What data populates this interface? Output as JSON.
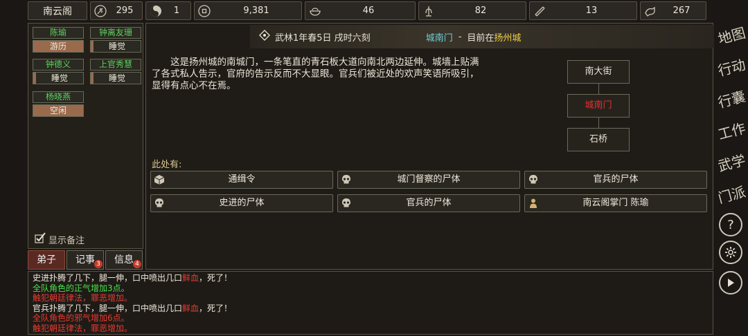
{
  "topbar": {
    "sect_name": "南云阁",
    "resources": [
      {
        "icon": "wheat-icon",
        "value": "295"
      },
      {
        "icon": "yinyang-icon",
        "value": "1"
      },
      {
        "icon": "coin-icon",
        "value": "9,381"
      },
      {
        "icon": "food-bowl-icon",
        "value": "46"
      },
      {
        "icon": "herb-icon",
        "value": "82"
      },
      {
        "icon": "scroll-icon",
        "value": "13"
      },
      {
        "icon": "beast-icon",
        "value": "267"
      }
    ]
  },
  "members": [
    {
      "name": "陈瑜",
      "state": "游历"
    },
    {
      "name": "钟离友珊",
      "state": "睡觉"
    },
    {
      "name": "钟德义",
      "state": "睡觉"
    },
    {
      "name": "上官秀慧",
      "state": "睡觉"
    },
    {
      "name": "杨晓燕",
      "state": "空闲"
    }
  ],
  "left": {
    "show_notes": "显示备注"
  },
  "tabs": [
    {
      "label": "弟子",
      "badge": ""
    },
    {
      "label": "记事",
      "badge": "3"
    },
    {
      "label": "信息",
      "badge": "4"
    }
  ],
  "header": {
    "date": "武林1年春5日 戌时六刻",
    "location": "城南门",
    "separator": "-",
    "now_label": "目前在",
    "city": "扬州城"
  },
  "description": "这是扬州城的南城门，一条笔直的青石板大道向南北两边延伸。城墙上贴满了各式私人告示，官府的告示反而不大显眼。官兵们被近处的欢声笑语所吸引，显得有点心不在焉。",
  "map_nodes": {
    "north": "南大街",
    "current": "城南门",
    "south": "石桥"
  },
  "here_label": "此处有:",
  "entities": [
    {
      "icon": "box-icon",
      "label": "通缉令"
    },
    {
      "icon": "skull-icon",
      "label": "城门督察的尸体"
    },
    {
      "icon": "skull-icon",
      "label": "官兵的尸体"
    },
    {
      "icon": "skull-icon",
      "label": "史进的尸体"
    },
    {
      "icon": "skull-icon",
      "label": "官兵的尸体"
    },
    {
      "icon": "person-icon",
      "label": "南云阁掌门 陈瑜"
    }
  ],
  "log": [
    {
      "pre": "史进扑腾了几下，腿一伸，口中喷出几口",
      "hl": "鲜血",
      "post": "，死了！",
      "color": "w"
    },
    {
      "pre": "全队角色的正气增加3点。",
      "hl": "",
      "post": "",
      "color": "g"
    },
    {
      "pre": "触犯朝廷律法，罪恶增加。",
      "hl": "",
      "post": "",
      "color": "r"
    },
    {
      "pre": "官兵扑腾了几下，腿一伸，口中喷出几口",
      "hl": "鲜血",
      "post": "，死了！",
      "color": "w"
    },
    {
      "pre": "全队角色的邪气增加6点。",
      "hl": "",
      "post": "",
      "color": "r"
    },
    {
      "pre": "触犯朝廷律法，罪恶增加。",
      "hl": "",
      "post": "",
      "color": "r"
    }
  ],
  "right_menu": [
    "地图",
    "行动",
    "行囊",
    "工作",
    "武学",
    "门派"
  ],
  "colors": {
    "accent_green": "#4ae04a",
    "accent_red": "#e83a30",
    "city_yellow": "#f0d048",
    "loc_cyan": "#6fd0d8"
  }
}
